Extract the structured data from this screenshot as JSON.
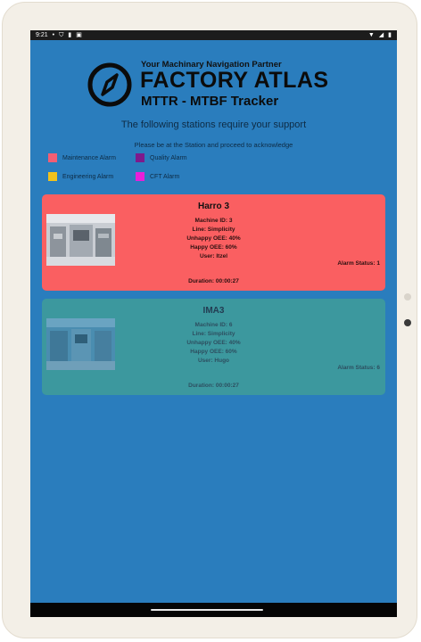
{
  "status_bar": {
    "time": "9:21",
    "left_icons": [
      "notification-dot-icon",
      "shield-icon",
      "sim-card-icon",
      "app-notification-icon"
    ],
    "right_icons": [
      "wifi-icon",
      "signal-icon",
      "battery-icon"
    ]
  },
  "header": {
    "tagline": "Your Machinary Navigation Partner",
    "brand": "FACTORY ATLAS",
    "subtitle": "MTTR - MTBF Tracker",
    "logo_icon": "compass-icon"
  },
  "messages": {
    "support": "The following stations require your support",
    "instruction": "Please be at the Station and proceed to acknowledge"
  },
  "legend": [
    {
      "label": "Maintenance Alarm",
      "color": "#f45e74"
    },
    {
      "label": "Quality Alarm",
      "color": "#7d1a8c"
    },
    {
      "label": "Engineering Alarm",
      "color": "#f2c21b"
    },
    {
      "label": "CFT Alarm",
      "color": "#e81fd9"
    }
  ],
  "stations": [
    {
      "name": "Harro 3",
      "machine_id": "Machine ID: 3",
      "line": "Line: Simplicity",
      "unhappy_oee": "Unhappy OEE: 40%",
      "happy_oee": "Happy OEE: 60%",
      "user": "User: Itzel",
      "alarm_status": "Alarm Status: 1",
      "duration": "Duration: 00:00:27",
      "color": "#fa5f61"
    },
    {
      "name": "IMA3",
      "machine_id": "Machine ID: 6",
      "line": "Line: Simplicity",
      "unhappy_oee": "Unhappy OEE: 40%",
      "happy_oee": "Happy OEE: 60%",
      "user": "User: Hugo",
      "alarm_status": "Alarm Status: 6",
      "duration": "Duration: 00:00:27",
      "color": "#3c989e"
    }
  ]
}
